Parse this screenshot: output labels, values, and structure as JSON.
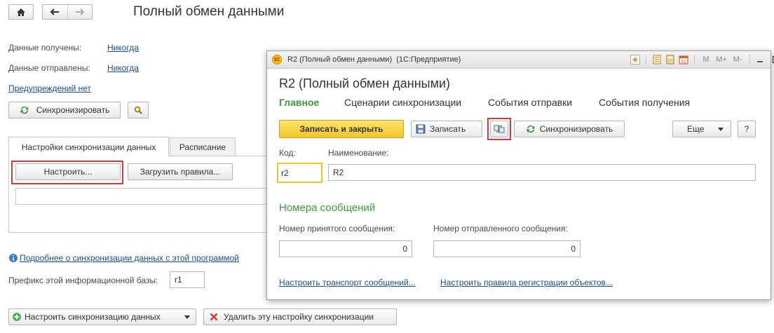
{
  "main": {
    "title": "Полный обмен данными",
    "received_label": "Данные получены:",
    "received_value": "Никогда",
    "sent_label": "Данные отправлены:",
    "sent_value": "Никогда",
    "warnings_link": "Предупреждений нет",
    "sync_button": "Синхронизировать",
    "tabs": [
      {
        "label": "Настройки синхронизации данных"
      },
      {
        "label": "Расписание"
      }
    ],
    "configure_button": "Настроить...",
    "load_rules_button": "Загрузить правила...",
    "more_info_link": "Подробнее о синхронизации данных с этой программой",
    "prefix_label": "Префикс этой информационной базы:",
    "prefix_value": "r1",
    "setup_sync_button": "Настроить синхронизацию данных",
    "delete_setup_button": "Удалить эту настройку синхронизации"
  },
  "dialog": {
    "window_title": "R2 (Полный обмен данными)  (1С:Предприятие)",
    "titlebar_m": "M",
    "titlebar_mplus": "M+",
    "titlebar_mminus": "M-",
    "heading": "R2 (Полный обмен данными)",
    "tabs": [
      {
        "label": "Главное"
      },
      {
        "label": "Сценарии синхронизации"
      },
      {
        "label": "События отправки"
      },
      {
        "label": "События получения"
      }
    ],
    "save_close_button": "Записать и закрыть",
    "save_button": "Записать",
    "sync_button": "Синхронизировать",
    "more_button": "Еще",
    "help_button": "?",
    "code_label": "Код:",
    "code_value": "r2",
    "name_label": "Наименование:",
    "name_value": "R2",
    "messages_section": "Номера сообщений",
    "received_msg_label": "Номер принятого сообщения:",
    "received_msg_value": "0",
    "sent_msg_label": "Номер отправленного сообщения:",
    "sent_msg_value": "0",
    "transport_link": "Настроить транспорт сообщений...",
    "registration_link": "Настроить правила регистрации объектов..."
  },
  "colors": {
    "accent_green": "#3b9b3b",
    "primary_yellow": "#f7d336",
    "highlight_red": "#d9373a",
    "link_blue": "#1a4c9e"
  }
}
